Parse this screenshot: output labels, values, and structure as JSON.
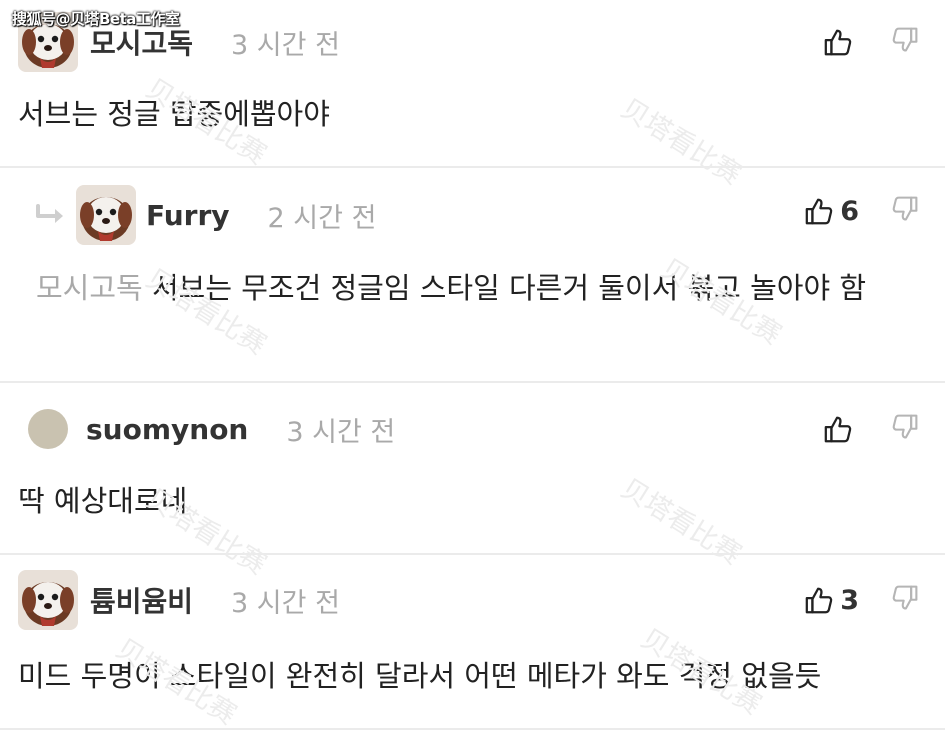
{
  "source_tag": "搜狐号@贝塔Beta工作室",
  "watermark": "贝塔看比赛",
  "colors": {
    "text": "#222222",
    "muted": "#a9a9a9",
    "divider": "#ebebeb"
  },
  "comments": [
    {
      "username": "모시고독",
      "time": "3 시간 전",
      "like_count": "",
      "body": "서브는 정글 탑중에뽑아야",
      "avatar": "dog-avatar"
    },
    {
      "username": "Furry",
      "time": "2 시간 전",
      "like_count": "6",
      "mention": "모시고독",
      "body": "서브는 무조건 정글임 스타일 다른거 둘이서 볶고 놀아야 함",
      "avatar": "dog-avatar",
      "is_reply": true
    },
    {
      "username": "suomynon",
      "time": "3 시간 전",
      "like_count": "",
      "body": "딱 예상대로네",
      "avatar": "round-avatar"
    },
    {
      "username": "튬비윰비",
      "time": "3 시간 전",
      "like_count": "3",
      "body": "미드 두명이 스타일이 완전히 달라서 어떤 메타가 와도 걱정 없을듯",
      "avatar": "dog-avatar"
    }
  ],
  "icons": {
    "like": "thumbs-up-icon",
    "dislike": "thumbs-down-icon",
    "reply": "reply-arrow-icon"
  }
}
